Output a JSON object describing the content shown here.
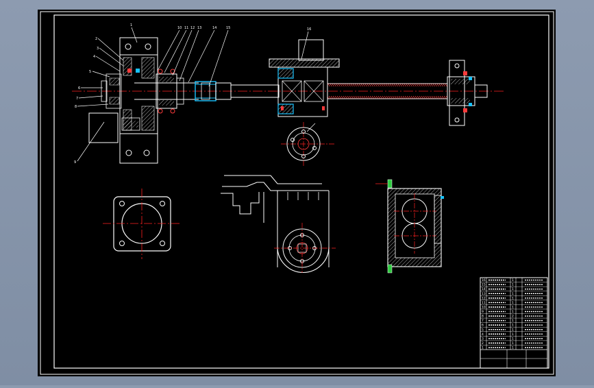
{
  "app": {
    "canvas_color": "#000000",
    "workspace_color": "#8c9aaf",
    "line_color": "#ffffff",
    "centerline_color": "#ff2020",
    "accent_colors": [
      "#19c3ff",
      "#ff3b3b",
      "#2ecc40"
    ]
  },
  "drawing": {
    "leader_labels": [
      "1",
      "2",
      "3",
      "4",
      "5",
      "6",
      "7",
      "8",
      "9",
      "10",
      "11",
      "12",
      "13",
      "14",
      "15",
      "16"
    ]
  },
  "title_block": {
    "rows": [
      {
        "no": "16",
        "name": "",
        "qty": "1",
        "material": ""
      },
      {
        "no": "15",
        "name": "",
        "qty": "1",
        "material": ""
      },
      {
        "no": "14",
        "name": "",
        "qty": "1",
        "material": ""
      },
      {
        "no": "13",
        "name": "",
        "qty": "1",
        "material": ""
      },
      {
        "no": "12",
        "name": "",
        "qty": "1",
        "material": ""
      },
      {
        "no": "11",
        "name": "",
        "qty": "1",
        "material": ""
      },
      {
        "no": "10",
        "name": "",
        "qty": "1",
        "material": ""
      },
      {
        "no": "9",
        "name": "",
        "qty": "1",
        "material": ""
      },
      {
        "no": "8",
        "name": "",
        "qty": "2",
        "material": ""
      },
      {
        "no": "7",
        "name": "",
        "qty": "1",
        "material": ""
      },
      {
        "no": "6",
        "name": "",
        "qty": "1",
        "material": ""
      },
      {
        "no": "5",
        "name": "",
        "qty": "1",
        "material": ""
      },
      {
        "no": "4",
        "name": "",
        "qty": "1",
        "material": ""
      },
      {
        "no": "3",
        "name": "",
        "qty": "1",
        "material": ""
      },
      {
        "no": "2",
        "name": "",
        "qty": "1",
        "material": ""
      },
      {
        "no": "1",
        "name": "",
        "qty": "1",
        "material": ""
      }
    ]
  }
}
